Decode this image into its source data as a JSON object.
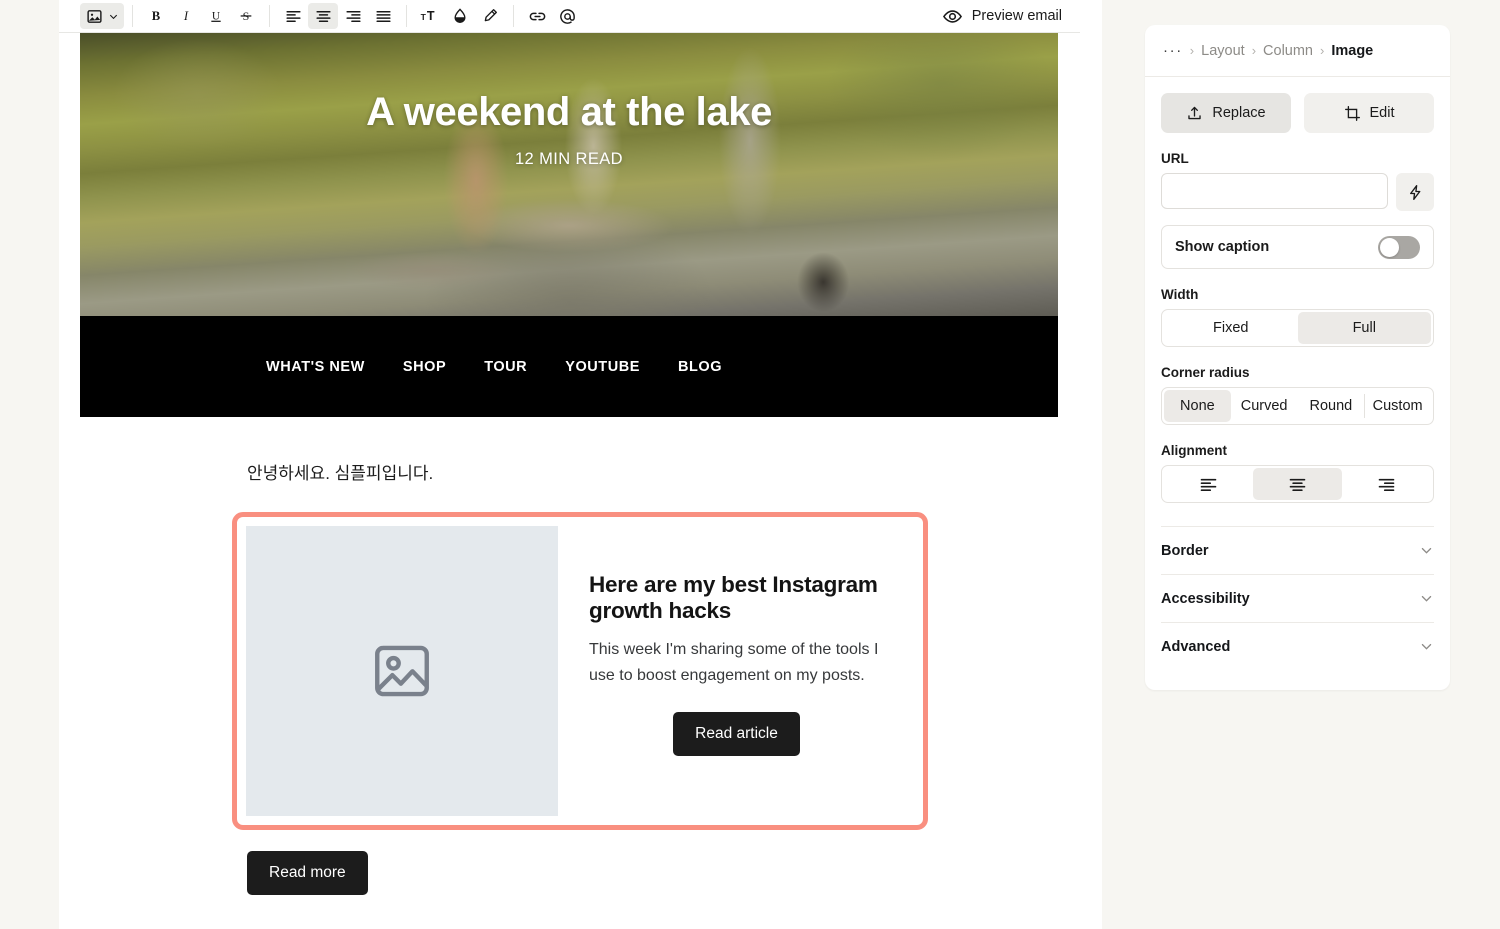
{
  "toolbar": {
    "image_dropdown": {
      "icon": "image-icon",
      "caret": "chevron-down-icon"
    },
    "bold_label": "B",
    "italic_label": "I",
    "underline_label": "U",
    "strikethrough_label": "S",
    "align_left": "align-left-icon",
    "align_center": "align-center-icon",
    "align_right": "align-right-icon",
    "align_justify": "align-justify-icon",
    "font_size": "font-size-icon",
    "text_color": "text-color-icon",
    "highlight": "highlighter-icon",
    "link": "link-icon",
    "mention": "at-mention-icon",
    "preview_label": "Preview email"
  },
  "email": {
    "hero": {
      "title": "A weekend at the lake",
      "subtitle": "12 MIN READ"
    },
    "nav": [
      {
        "label": "WHAT'S NEW"
      },
      {
        "label": "SHOP"
      },
      {
        "label": "TOUR"
      },
      {
        "label": "YOUTUBE"
      },
      {
        "label": "BLOG"
      }
    ],
    "greeting": "안녕하세요. 심플피입니다.",
    "feature": {
      "image_placeholder_icon": "image-placeholder-icon",
      "heading": "Here are my best Instagram growth hacks",
      "paragraph": "This week I'm sharing some of the tools I use to boost engagement on my posts.",
      "cta_label": "Read article",
      "selection_color": "#f98f80",
      "placeholder_bg": "#e4e9ed"
    },
    "read_more_label": "Read more",
    "button_color": "#1c1c1c"
  },
  "inspector": {
    "breadcrumb": {
      "overflow": "···",
      "items": [
        {
          "label": "Layout",
          "current": false
        },
        {
          "label": "Column",
          "current": false
        },
        {
          "label": "Image",
          "current": true
        }
      ],
      "separator": "›"
    },
    "replace_label": "Replace",
    "edit_label": "Edit",
    "url": {
      "label": "URL",
      "value": "",
      "placeholder": "",
      "action_icon": "lightning-bolt-icon"
    },
    "show_caption": {
      "label": "Show caption",
      "enabled": false
    },
    "width": {
      "label": "Width",
      "options": [
        "Fixed",
        "Full"
      ],
      "selected": "Full"
    },
    "corner_radius": {
      "label": "Corner radius",
      "options": [
        "None",
        "Curved",
        "Round",
        "Custom"
      ],
      "selected": "None"
    },
    "alignment": {
      "label": "Alignment",
      "options": [
        "align-left-icon",
        "align-center-icon",
        "align-right-icon"
      ],
      "selected": "align-center-icon"
    },
    "sections": [
      {
        "label": "Border"
      },
      {
        "label": "Accessibility"
      },
      {
        "label": "Advanced"
      }
    ]
  }
}
